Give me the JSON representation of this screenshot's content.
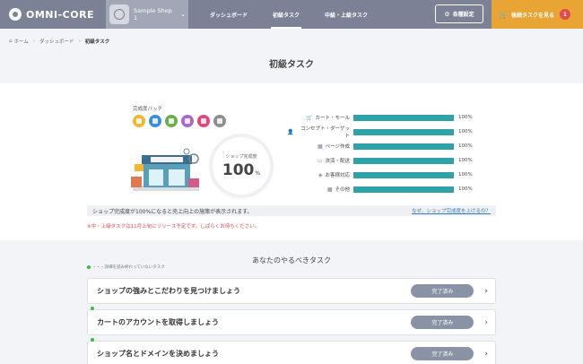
{
  "header": {
    "logo_text": "OMNI-CORE",
    "shop_name": "Sample Shop 1",
    "nav": [
      "ダッシュボード",
      "初級タスク",
      "中級・上級タスク"
    ],
    "settings_label": "各種設定",
    "next_label": "後続タスクを見る",
    "next_badge": "1",
    "brand_color": "#7b8296",
    "accent_color": "#e8a533"
  },
  "breadcrumb": [
    "ホーム",
    "ダッシュボード",
    "初級タスク"
  ],
  "page_title": "初級タスク",
  "summary": {
    "badge_label": "完成度バッチ",
    "badges": [
      "#f0b830",
      "#3a8fd8",
      "#6ab04c",
      "#a96acb",
      "#e3457d",
      "#8e8e8e"
    ],
    "gauge_label": "ショップ完成度",
    "gauge_value": "100",
    "gauge_unit": "%",
    "progress": [
      {
        "icon": "cart-icon",
        "glyph": "🛒",
        "label": "カート・モール",
        "value": 100,
        "text": "100%"
      },
      {
        "icon": "person-icon",
        "glyph": "👤",
        "label": "コンセプト・ターゲット",
        "value": 100,
        "text": "100%"
      },
      {
        "icon": "page-icon",
        "glyph": "▦",
        "label": "ページ作成",
        "value": 100,
        "text": "100%"
      },
      {
        "icon": "card-icon",
        "glyph": "▭",
        "label": "決済・配送",
        "value": 100,
        "text": "100%"
      },
      {
        "icon": "chat-icon",
        "glyph": "◈",
        "label": "お客様対応",
        "value": 100,
        "text": "100%"
      },
      {
        "icon": "grid-icon",
        "glyph": "▦",
        "label": "その他",
        "value": 100,
        "text": "100%"
      }
    ],
    "bar_color": "#2fa3a7",
    "notice_text": "ショップ完成度が100%になると売上向上の施策が表示されます。",
    "notice_link": "なぜ、ショップ完成度を上げるの？",
    "release_note": "※中・上級タスクは11月上旬にリリース予定です。しばらくお待ちください。"
  },
  "tasks": {
    "title": "あなたのやるべきタスク",
    "legend": "・・・詳細を読み終わっていないタスク",
    "items": [
      {
        "text": "ショップの強みとこだわりを見つけましょう",
        "status": "完了済み",
        "unread": false
      },
      {
        "text": "カートのアカウントを取得しましょう",
        "status": "完了済み",
        "unread": true
      },
      {
        "text": "ショップ名とドメインを決めましょう",
        "status": "完了済み",
        "unread": true
      }
    ]
  }
}
